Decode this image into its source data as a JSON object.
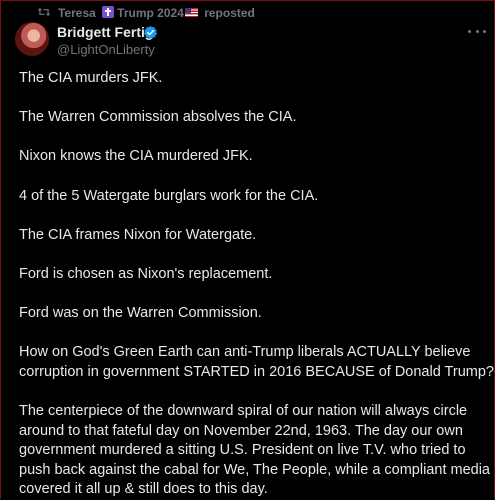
{
  "repost": {
    "name_part1": "Teresa",
    "name_part2": "Trump 2024",
    "label": "reposted"
  },
  "author": {
    "display_name": "Bridgett Fertig",
    "handle": "@LightOnLiberty"
  },
  "colors": {
    "background": "#000000",
    "text": "#e7e9ea",
    "muted": "#71767b",
    "verified": "#1d9bf0",
    "frame_border": "#7a0f12"
  },
  "icons": [
    "repost-icon",
    "cross-emoji-icon",
    "us-flag-icon",
    "avatar",
    "verified-badge-icon",
    "more-options-icon"
  ],
  "tweet": {
    "p1": "The CIA murders JFK.",
    "p2": "The Warren Commission absolves the CIA.",
    "p3": "Nixon knows the CIA murdered JFK.",
    "p4": "4 of the 5 Watergate burglars work for the CIA.",
    "p5": "The CIA frames Nixon for Watergate.",
    "p6": "Ford is chosen as Nixon's replacement.",
    "p7": "Ford was on the Warren Commission.",
    "p8_l1": "How on God's Green Earth can anti-Trump liberals ACTUALLY believe",
    "p8_l2": "corruption in government STARTED in 2016 BECAUSE of Donald Trump?",
    "p9_l1": "The centerpiece of the downward spiral of our nation will always circle",
    "p9_l2": "around to that fateful day on November 22nd, 1963. The day our own",
    "p9_l3": "government murdered a sitting U.S. President on live T.V. who tried to",
    "p9_l4": "push back against the cabal for We, The People, while a compliant media",
    "p9_l5": "covered it all up & still does to this day."
  }
}
